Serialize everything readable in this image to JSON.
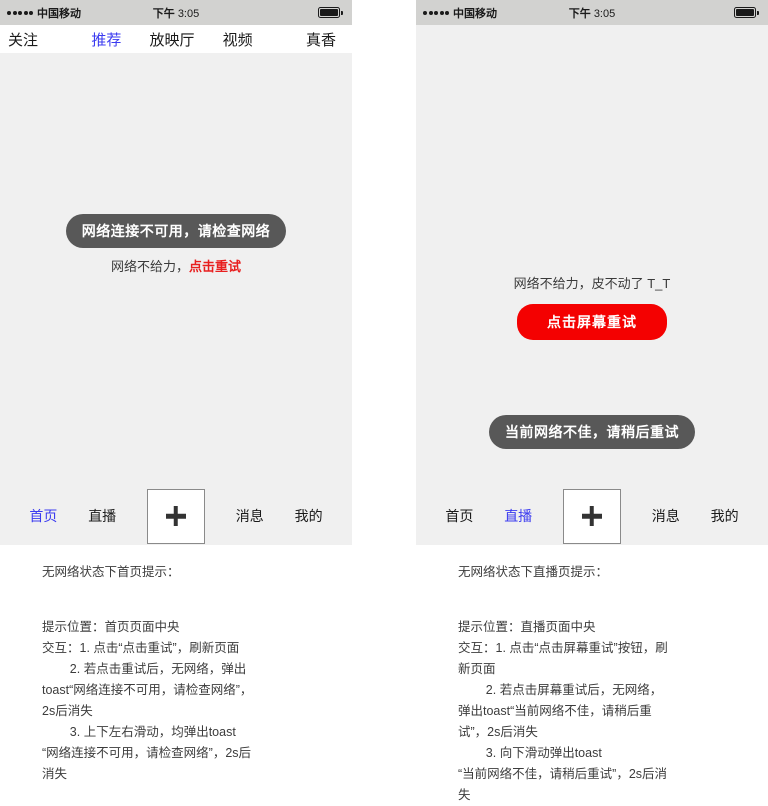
{
  "status_bar": {
    "signal_dots": 5,
    "carrier": "中国移动",
    "ampm": "下午",
    "time": "3:05",
    "battery_icon": "battery-full-icon"
  },
  "left_phone": {
    "top_tabs": [
      {
        "label": "关注",
        "active": false
      },
      {
        "label": "推荐",
        "active": true
      },
      {
        "label": "放映厅",
        "active": false
      },
      {
        "label": "视频",
        "active": false
      },
      {
        "label": "真香",
        "active": false
      }
    ],
    "toast": "网络连接不可用，请检查网络",
    "retry_prefix": "网络不给力，",
    "retry_link": "点击重试",
    "bottom_nav": [
      {
        "label": "首页",
        "active": true
      },
      {
        "label": "直播",
        "active": false
      },
      {
        "label": "+",
        "active": false,
        "icon": "plus-icon"
      },
      {
        "label": "消息",
        "active": false
      },
      {
        "label": "我的",
        "active": false
      }
    ],
    "notes": {
      "title": "无网络状态下首页提示：",
      "position": "提示位置：首页页面中央",
      "interaction_1": "交互：1. 点击“点击重试”，刷新页面",
      "interaction_2": "        2. 若点击重试后，无网络，弹出\ntoast“网络连接不可用，请检查网络”，\n2s后消失",
      "interaction_3": "        3. 上下左右滑动，均弹出toast\n“网络连接不可用，请检查网络”，2s后\n消失"
    }
  },
  "right_phone": {
    "hint": "网络不给力，皮不动了 T_T",
    "retry_button": "点击屏幕重试",
    "toast": "当前网络不佳，请稍后重试",
    "bottom_nav": [
      {
        "label": "首页",
        "active": false
      },
      {
        "label": "直播",
        "active": true
      },
      {
        "label": "+",
        "active": false,
        "icon": "plus-icon"
      },
      {
        "label": "消息",
        "active": false
      },
      {
        "label": "我的",
        "active": false
      }
    ],
    "notes": {
      "title": "无网络状态下直播页提示：",
      "position": "提示位置：直播页面中央",
      "interaction_1": "交互：1. 点击“点击屏幕重试”按钮，刷\n新页面",
      "interaction_2": "        2. 若点击屏幕重试后，无网络，\n弹出toast“当前网络不佳，请稍后重\n试”，2s后消失",
      "interaction_3": "        3. 向下滑动弹出toast\n“当前网络不佳，请稍后重试”，2s后消\n失"
    }
  },
  "colors": {
    "accent_blue": "#3b3bf0",
    "retry_red": "#e81f1f",
    "button_red": "#f40101",
    "toast_gray": "#585858",
    "screen_bg": "#f0f0f0",
    "status_bar_bg": "#d2d2d0"
  }
}
